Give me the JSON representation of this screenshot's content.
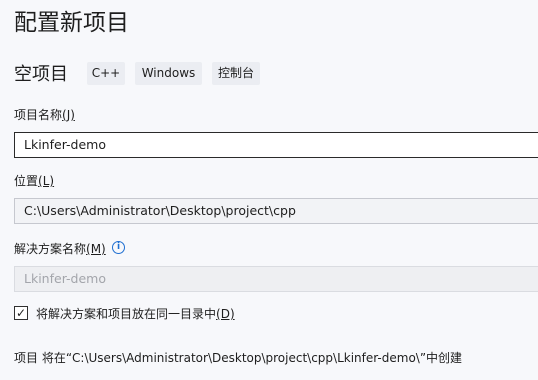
{
  "page_title": "配置新项目",
  "template": {
    "name": "空项目",
    "tags": [
      "C++",
      "Windows",
      "控制台"
    ]
  },
  "project_name": {
    "label": "项目名称",
    "mnemonic": "(J)",
    "value": "Lkinfer-demo"
  },
  "location": {
    "label": "位置",
    "mnemonic": "(L)",
    "value": "C:\\Users\\Administrator\\Desktop\\project\\cpp"
  },
  "solution_name": {
    "label": "解决方案名称",
    "mnemonic": "(M)",
    "placeholder": "Lkinfer-demo",
    "info_icon": "info-circle-icon"
  },
  "same_directory": {
    "checked": true,
    "label": "将解决方案和项目放在同一目录中",
    "mnemonic": "(D)"
  },
  "summary": "项目 将在“C:\\Users\\Administrator\\Desktop\\project\\cpp\\Lkinfer-demo\\”中创建",
  "colors": {
    "accent": "#1f6fd1",
    "background": "#f7f8fb"
  }
}
